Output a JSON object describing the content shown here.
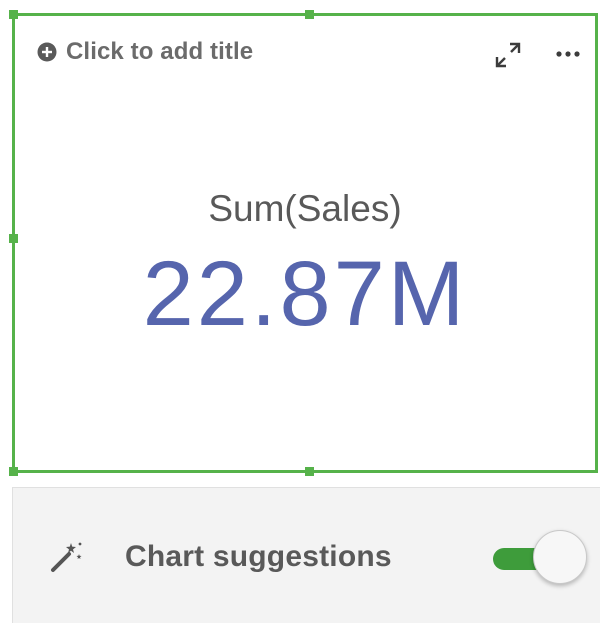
{
  "kpi_object": {
    "title_placeholder": "Click to add title",
    "measure_label": "Sum(Sales)",
    "measure_value": "22.87M",
    "icons": {
      "add_title": "plus-circle-icon",
      "expand": "expand-icon",
      "more": "more-options-icon"
    },
    "colors": {
      "selection_border": "#56b24a",
      "value_text": "#5665ad",
      "label_text": "#595959"
    }
  },
  "suggestions_panel": {
    "label": "Chart suggestions",
    "icon": "magic-wand-icon",
    "toggle_on": true,
    "colors": {
      "toggle_track": "#3e9c3b",
      "panel_background": "#f3f3f3"
    }
  }
}
